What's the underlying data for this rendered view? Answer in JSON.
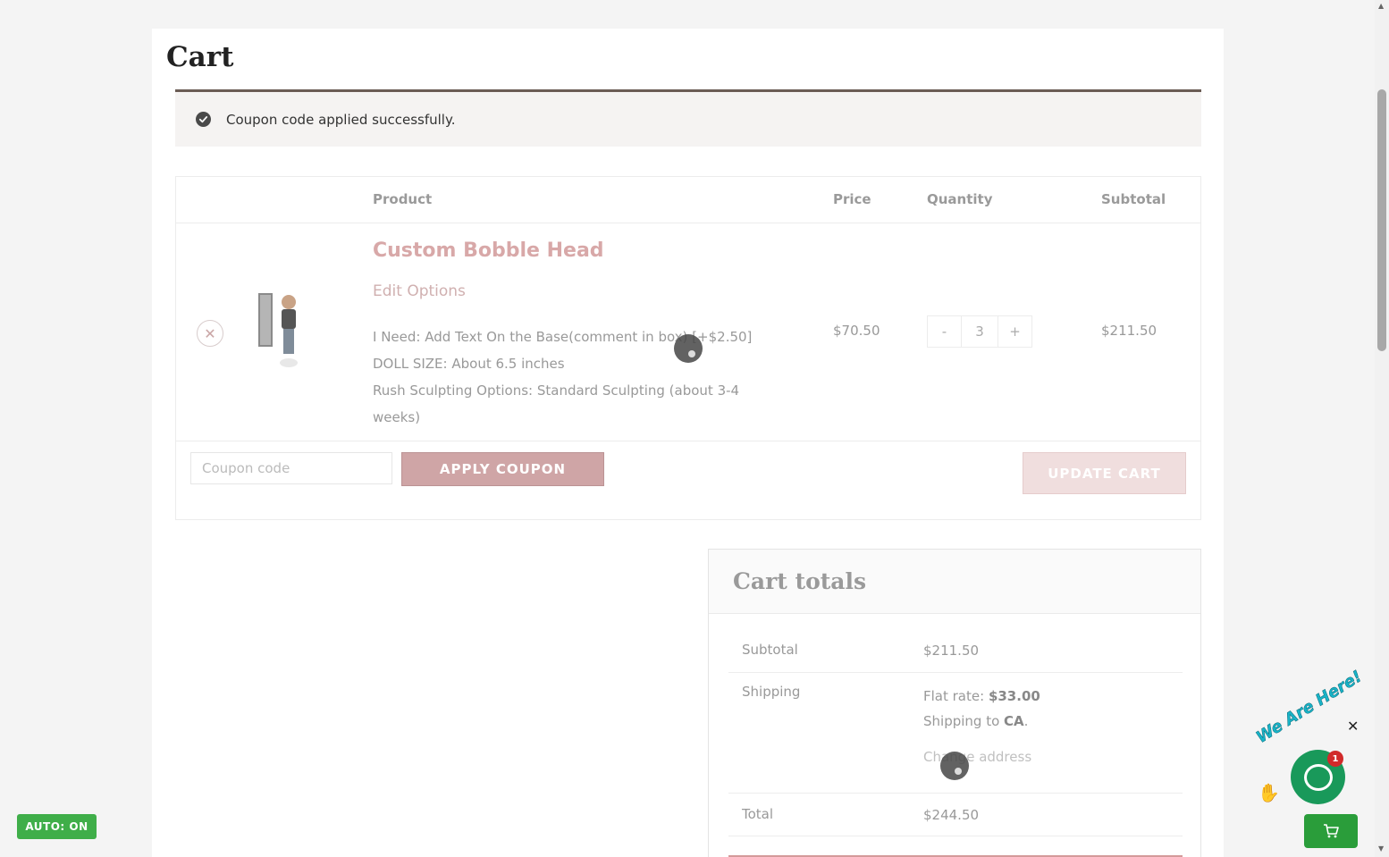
{
  "page": {
    "title": "Cart"
  },
  "notice": {
    "text": "Coupon code applied successfully."
  },
  "table": {
    "headers": {
      "product": "Product",
      "price": "Price",
      "quantity": "Quantity",
      "subtotal": "Subtotal"
    },
    "row": {
      "product_name": "Custom Bobble Head",
      "edit_label": "Edit Options",
      "meta": [
        "I Need: Add Text On the Base(comment in box) [+$2.50]",
        "DOLL SIZE: About 6.5 inches",
        "Rush Sculpting Options: Standard Sculpting (about 3-4 weeks)"
      ],
      "price": "$70.50",
      "qty_minus": "-",
      "qty_value": "3",
      "qty_plus": "+",
      "subtotal": "$211.50"
    }
  },
  "coupon": {
    "placeholder": "Coupon code",
    "apply_label": "APPLY COUPON",
    "update_label": "UPDATE CART"
  },
  "totals": {
    "title": "Cart totals",
    "subtotal_label": "Subtotal",
    "subtotal_value": "$211.50",
    "shipping_label": "Shipping",
    "shipping_method": "Flat rate: ",
    "shipping_amount": "$33.00",
    "shipping_to_prefix": "Shipping to ",
    "shipping_to_region": "CA",
    "shipping_to_suffix": ".",
    "change_address": "Change address",
    "total_label": "Total",
    "total_value": "$244.50"
  },
  "widgets": {
    "auto_badge": "AUTO: ON",
    "chat_banner": "We Are Here!",
    "chat_badge_count": "1",
    "chat_close": "✕"
  },
  "colors": {
    "accent": "#cfa5a6",
    "success": "#3fae49",
    "chat": "#19995a"
  }
}
